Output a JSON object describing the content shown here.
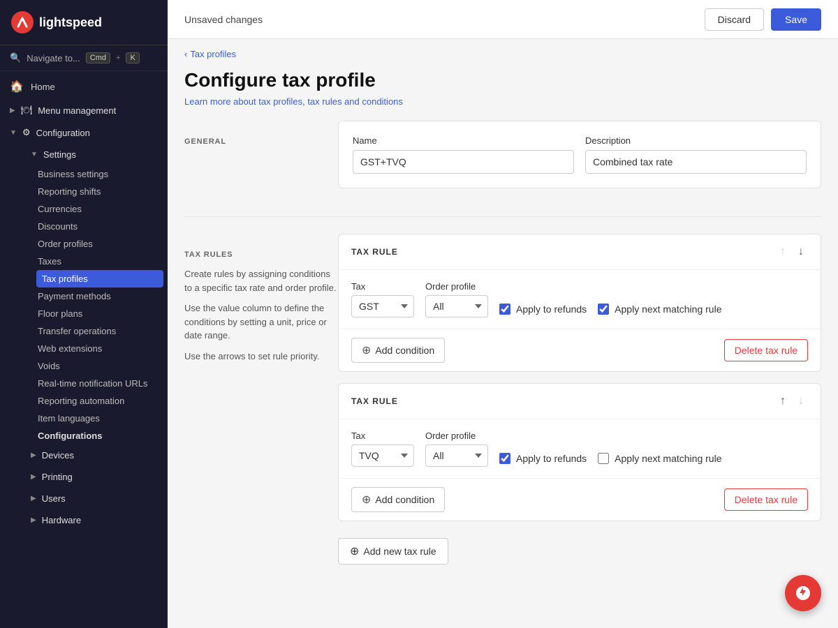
{
  "sidebar": {
    "logo_text": "lightspeed",
    "nav_search_label": "Navigate to...",
    "nav_search_cmd": "Cmd",
    "nav_search_k": "K",
    "items": {
      "home": "Home",
      "menu_management": "Menu management",
      "configuration": "Configuration",
      "settings": "Settings",
      "business_settings": "Business settings",
      "reporting_shifts": "Reporting shifts",
      "currencies": "Currencies",
      "discounts": "Discounts",
      "order_profiles": "Order profiles",
      "taxes": "Taxes",
      "tax_profiles": "Tax profiles",
      "payment_methods": "Payment methods",
      "floor_plans": "Floor plans",
      "transfer_operations": "Transfer operations",
      "web_extensions": "Web extensions",
      "voids": "Voids",
      "real_time_urls": "Real-time notification URLs",
      "reporting_automation": "Reporting automation",
      "item_languages": "Item languages",
      "configurations": "Configurations",
      "devices": "Devices",
      "printing": "Printing",
      "users": "Users",
      "hardware": "Hardware"
    }
  },
  "topbar": {
    "title": "Unsaved changes",
    "discard_label": "Discard",
    "save_label": "Save"
  },
  "breadcrumb": {
    "label": "Tax profiles",
    "arrow": "‹"
  },
  "page": {
    "title": "Configure tax profile",
    "link_text": "Learn more about tax profiles, tax rules and conditions"
  },
  "general_section": {
    "label": "GENERAL",
    "name_label": "Name",
    "name_value": "GST+TVQ",
    "description_label": "Description",
    "description_value": "Combined tax rate"
  },
  "tax_rules_section": {
    "label": "TAX RULES",
    "description_line1": "Create rules by assigning conditions to a specific tax rate and order profile.",
    "description_line2": "Use the value column to define the conditions by setting a unit, price or date range.",
    "description_line3": "Use the arrows to set rule priority.",
    "rules": [
      {
        "id": "rule1",
        "title": "TAX RULE",
        "tax_label": "Tax",
        "tax_value": "GST",
        "tax_options": [
          "GST",
          "TVQ"
        ],
        "order_profile_label": "Order profile",
        "order_profile_value": "All",
        "order_profile_options": [
          "All"
        ],
        "apply_to_refunds_label": "Apply to refunds",
        "apply_to_refunds_checked": true,
        "apply_next_rule_label": "Apply next matching rule",
        "apply_next_rule_checked": true,
        "add_condition_label": "Add condition",
        "delete_rule_label": "Delete tax rule",
        "up_disabled": true,
        "down_disabled": false
      },
      {
        "id": "rule2",
        "title": "TAX RULE",
        "tax_label": "Tax",
        "tax_value": "TVQ",
        "tax_options": [
          "GST",
          "TVQ"
        ],
        "order_profile_label": "Order profile",
        "order_profile_value": "All",
        "order_profile_options": [
          "All"
        ],
        "apply_to_refunds_label": "Apply to refunds",
        "apply_to_refunds_checked": true,
        "apply_next_rule_label": "Apply next matching rule",
        "apply_next_rule_checked": false,
        "add_condition_label": "Add condition",
        "delete_rule_label": "Delete tax rule",
        "up_disabled": false,
        "down_disabled": true
      }
    ],
    "add_new_rule_label": "Add new tax rule"
  },
  "fab": {
    "icon": "🔥"
  }
}
